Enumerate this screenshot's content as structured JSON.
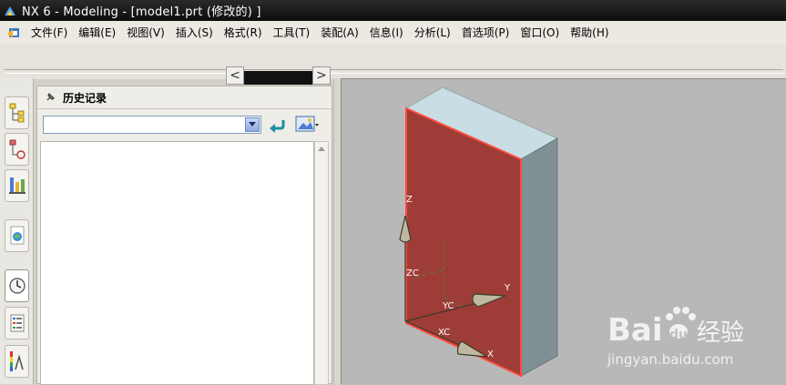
{
  "window": {
    "title": "NX 6 - Modeling - [model1.prt  (修改的)  ]"
  },
  "menu": {
    "items": [
      "文件(F)",
      "编辑(E)",
      "视图(V)",
      "插入(S)",
      "格式(R)",
      "工具(T)",
      "装配(A)",
      "信息(I)",
      "分析(L)",
      "首选项(P)",
      "窗口(O)",
      "帮助(H)"
    ]
  },
  "scrollbar": {
    "left_arrow": "<",
    "right_arrow": ">"
  },
  "resource_bar": {
    "tabs": [
      "assembly-navigator-icon",
      "constraint-navigator-icon",
      "part-navigator-icon",
      "web-browser-icon",
      "history-icon",
      "system-materials-icon",
      "process-studio-icon"
    ],
    "active": "history-icon"
  },
  "history_panel": {
    "title": "历史记录",
    "combo_value": ""
  },
  "viewport": {
    "axes": {
      "z_label": "Z",
      "zc_label": "ZC",
      "yc_label": "YC",
      "y_label": "Y",
      "xc_label": "XC",
      "x_label": "X"
    },
    "colors": {
      "front_face": "#9e3d38",
      "edge_highlight": "#ff4a3d",
      "top_face": "#c9dde4",
      "side_face": "#7e9093",
      "background": "#b8b8b8"
    }
  },
  "watermark": {
    "brand": "Bai",
    "brand2": "du",
    "suffix": "经验",
    "url": "jingyan.baidu.com"
  }
}
